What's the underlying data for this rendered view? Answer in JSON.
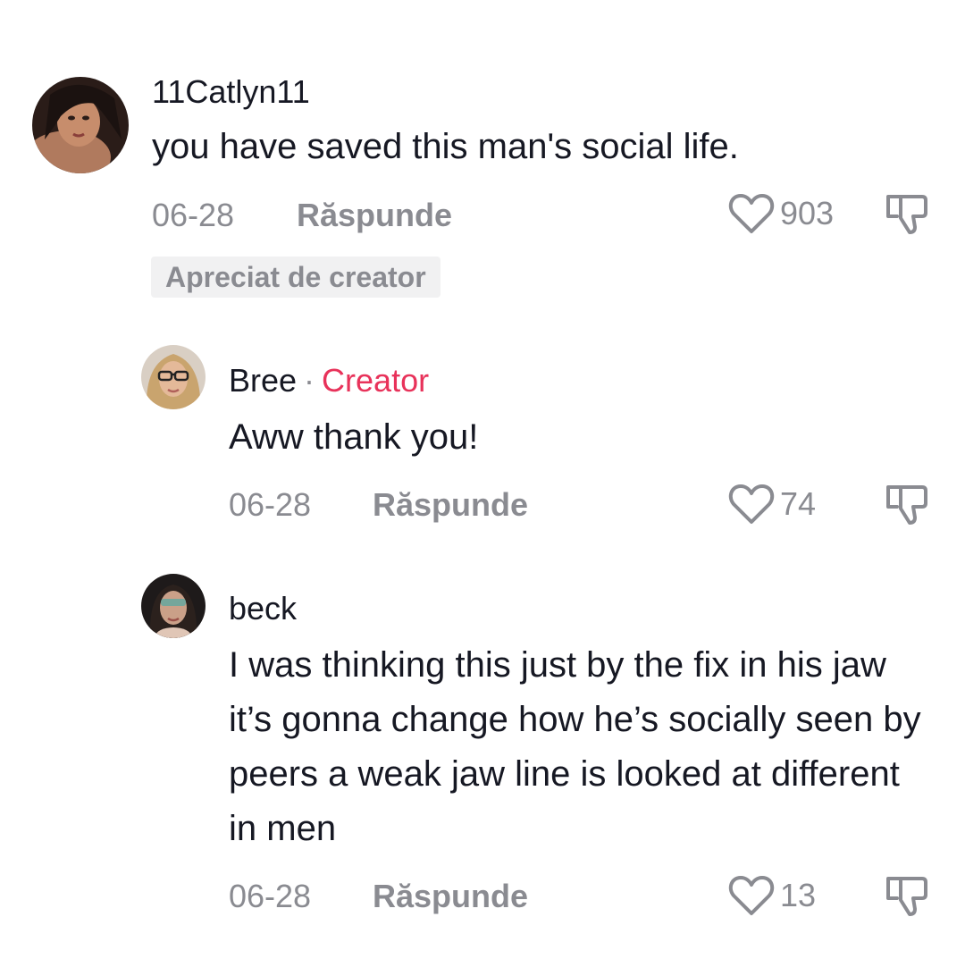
{
  "comments": [
    {
      "username": "11Catlyn11",
      "text": "you have saved this man's social life.",
      "date": "06-28",
      "reply_label": "Răspunde",
      "likes": "903",
      "badge": "Apreciat de creator",
      "avatar_icon": "user-avatar"
    },
    {
      "username": "Bree",
      "separator": "·",
      "role_label": "Creator",
      "text": "Aww thank you!",
      "date": "06-28",
      "reply_label": "Răspunde",
      "likes": "74",
      "avatar_icon": "user-avatar"
    },
    {
      "username": "beck",
      "text": "I was thinking this just by the fix in his jaw it’s gonna change how he’s socially seen by peers a weak jaw line is looked at different in men",
      "date": "06-28",
      "reply_label": "Răspunde",
      "likes": "13",
      "avatar_icon": "user-avatar"
    }
  ],
  "colors": {
    "text": "#161823",
    "muted": "#8a8b91",
    "creator": "#e8325a",
    "badge_bg": "#f1f1f2"
  },
  "icons": {
    "like": "heart-outline-icon",
    "dislike": "thumbs-down-outline-icon"
  }
}
